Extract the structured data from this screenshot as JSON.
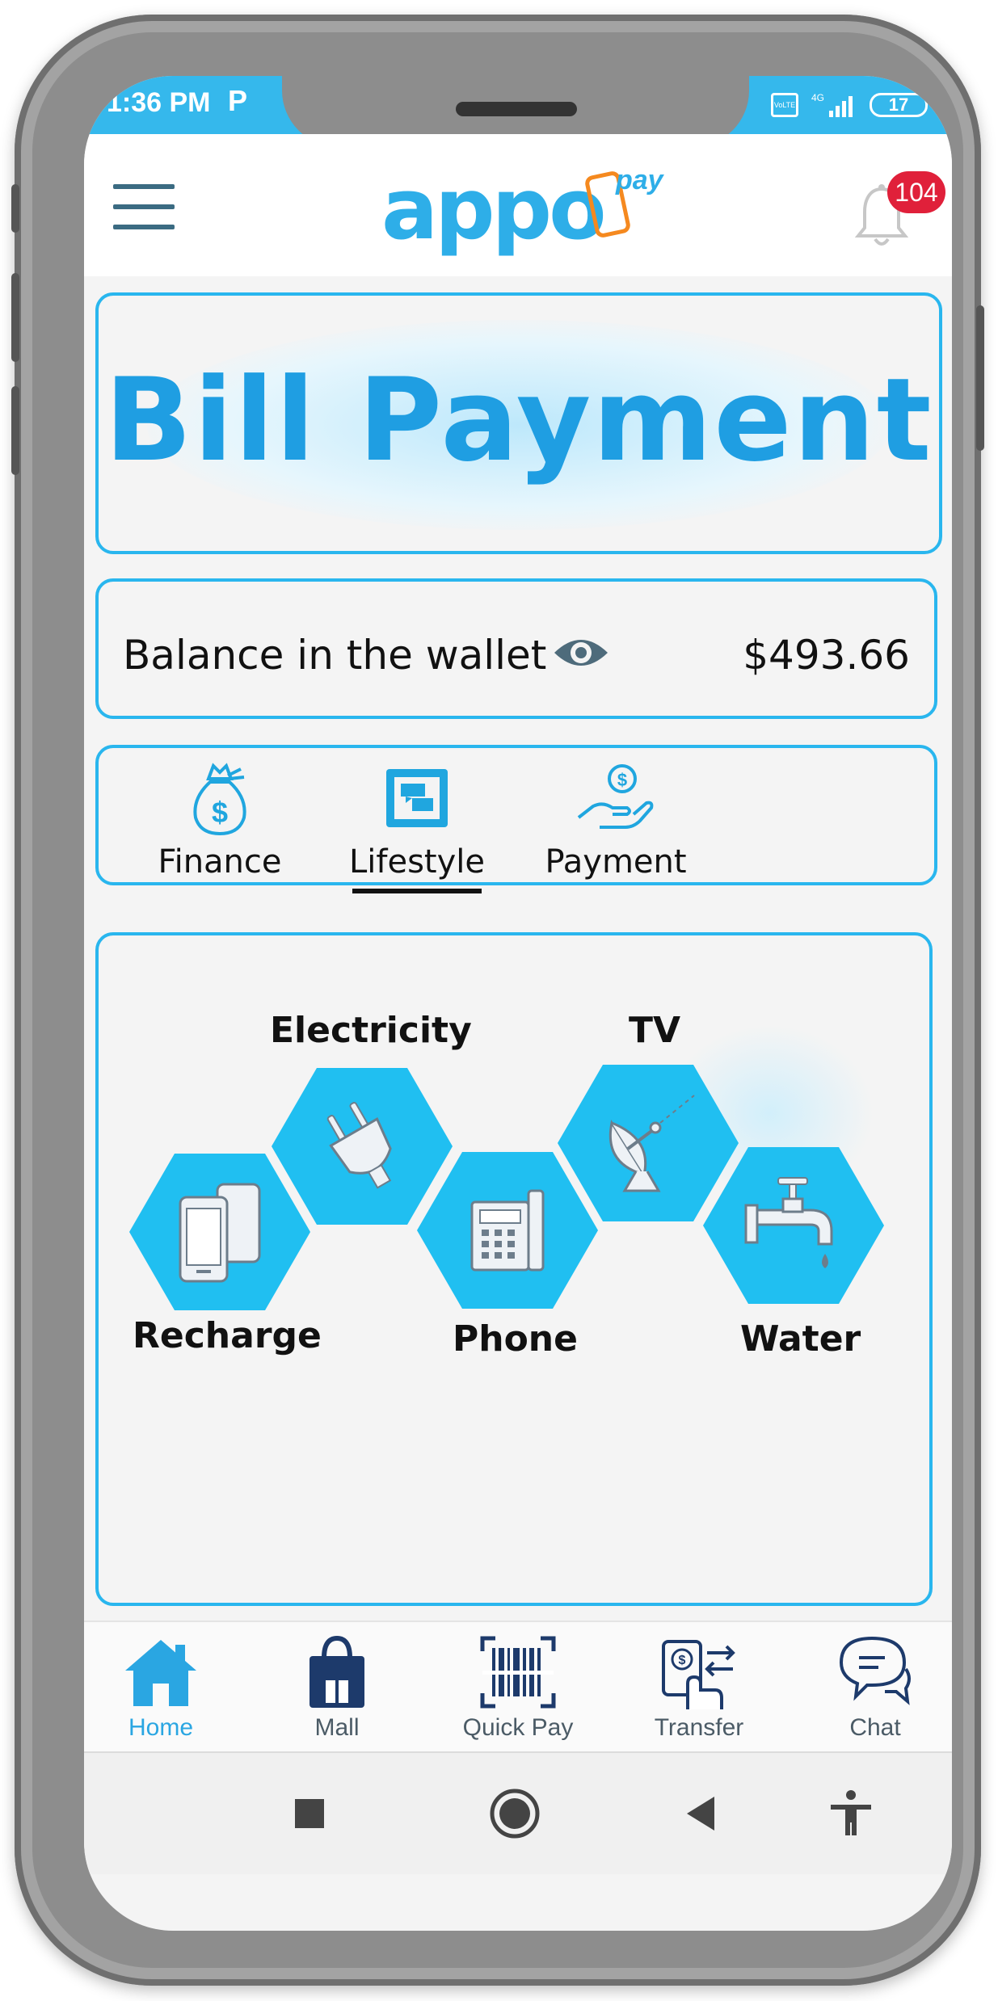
{
  "status_bar": {
    "time": "1:36 PM",
    "p_badge": "P",
    "volte": "VoLTE",
    "network": "4G",
    "battery": "17"
  },
  "header": {
    "logo_app": "appo",
    "logo_pay": "pay",
    "notification_count": "104"
  },
  "banner": {
    "title": "Bill Payment"
  },
  "wallet": {
    "label": "Balance in the wallet",
    "amount": "$493.66"
  },
  "tabs": [
    {
      "label": "Finance",
      "icon": "money-bag-icon",
      "active": false
    },
    {
      "label": "Lifestyle",
      "icon": "lifestyle-icon",
      "active": true
    },
    {
      "label": "Payment",
      "icon": "hand-coin-icon",
      "active": false
    }
  ],
  "services": [
    {
      "label": "Recharge",
      "icon": "mobile-phones-icon"
    },
    {
      "label": "Electricity",
      "icon": "plug-icon"
    },
    {
      "label": "Phone",
      "icon": "telephone-icon"
    },
    {
      "label": "TV",
      "icon": "satellite-dish-icon"
    },
    {
      "label": "Water",
      "icon": "water-tap-icon"
    }
  ],
  "bottom_nav": [
    {
      "label": "Home",
      "icon": "home-icon",
      "active": true
    },
    {
      "label": "Mall",
      "icon": "shopping-bag-icon",
      "active": false
    },
    {
      "label": "Quick Pay",
      "icon": "barcode-scan-icon",
      "active": false
    },
    {
      "label": "Transfer",
      "icon": "transfer-icon",
      "active": false
    },
    {
      "label": "Chat",
      "icon": "chat-icon",
      "active": false
    }
  ],
  "system_nav": [
    "recents-button",
    "home-button",
    "back-button",
    "accessibility-button"
  ],
  "colors": {
    "accent": "#29b6ee",
    "hexagon": "#20bff1",
    "banner_text": "#1f9ee2",
    "logo_orange": "#f5891f",
    "badge": "#e0203a"
  }
}
